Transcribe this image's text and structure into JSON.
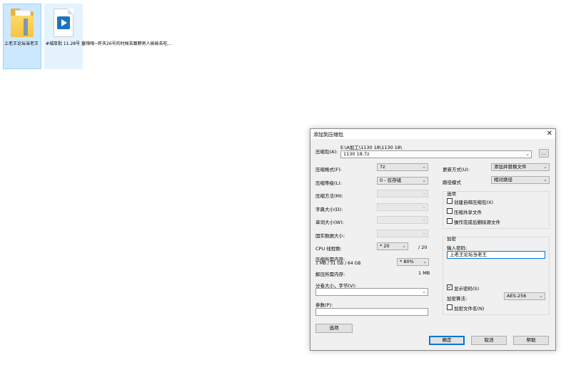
{
  "desktop": {
    "icons": [
      {
        "label": "上老王论坛当老王",
        "icon": "folder-icon"
      },
      {
        "label": "#城厚批 11.28号 童嗨嗨~昨天26号的时候去跟野男人偷偷去吃...",
        "icon": "video-file-icon"
      }
    ]
  },
  "dialog": {
    "title": "添加到压缩包",
    "archive_label": "压缩包(A):",
    "archive_path": "E:\\A加工\\1130 18\\1130 18\\",
    "archive_name": "1130 18.7z",
    "browse_label": "...",
    "format_label": "压缩格式(F):",
    "format_value": "7z",
    "level_label": "压缩等级(L):",
    "level_value": "0 - 仅存储",
    "method_label": "压缩方法(M):",
    "dict_label": "字典大小(D):",
    "word_label": "单词大小(W):",
    "solid_label": "固实数据大小:",
    "threads_label": "CPU 线程数:",
    "threads_value": "* 20",
    "threads_total": "/ 20",
    "mem_compress_label": "压缩所需内存:",
    "mem_compress_detail": "1 MB / 51 GB / 64 GB",
    "mem_percent": "* 80%",
    "mem_decompress_label": "解压所需内存:",
    "mem_decompress_value": "1 MB",
    "split_label": "分卷大小，字节(V):",
    "params_label": "参数(P):",
    "options_button": "选项",
    "update_label": "更新方式(U):",
    "update_value": "添加并替换文件",
    "path_mode_label": "路径模式",
    "path_mode_value": "相对路径",
    "options_group": "选项",
    "opt_sfx": "创建自释压缩包(X)",
    "opt_shared": "压缩共享文件",
    "opt_delete": "操作完成后删除源文件",
    "encrypt_group": "加密",
    "password_label": "输入密码:",
    "password_value": "上老王论坛当老王",
    "show_password": "显示密码(S)",
    "encrypt_method_label": "加密算法:",
    "encrypt_method_value": "AES-256",
    "encrypt_names": "加密文件名(N)",
    "ok": "确定",
    "cancel": "取消",
    "help": "帮助"
  },
  "colors": {
    "accent": "#0078d7",
    "selection": "#cce8ff"
  }
}
